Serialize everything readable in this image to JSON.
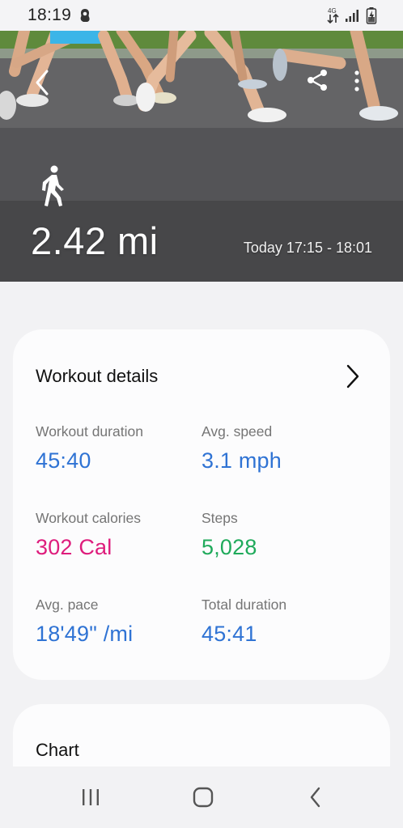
{
  "status_bar": {
    "time": "18:19"
  },
  "hero": {
    "distance": "2.42 mi",
    "time_range": "Today 17:15 - 18:01",
    "activity_icon": "walking-person-icon"
  },
  "details": {
    "title": "Workout details",
    "stats": [
      {
        "label": "Workout duration",
        "value": "45:40",
        "color": "#2f73d4"
      },
      {
        "label": "Avg. speed",
        "value": "3.1 mph",
        "color": "#2f73d4"
      },
      {
        "label": "Workout calories",
        "value": "302 Cal",
        "color": "#de1c7c"
      },
      {
        "label": "Steps",
        "value": "5,028",
        "color": "#1faa5b"
      },
      {
        "label": "Avg. pace",
        "value": "18'49\" /mi",
        "color": "#2f73d4"
      },
      {
        "label": "Total duration",
        "value": "45:41",
        "color": "#2f73d4"
      }
    ]
  },
  "chart_section": {
    "title": "Chart"
  },
  "nav": {
    "recents_icon": "recent-apps-icon",
    "home_icon": "home-icon",
    "back_icon": "back-icon"
  }
}
